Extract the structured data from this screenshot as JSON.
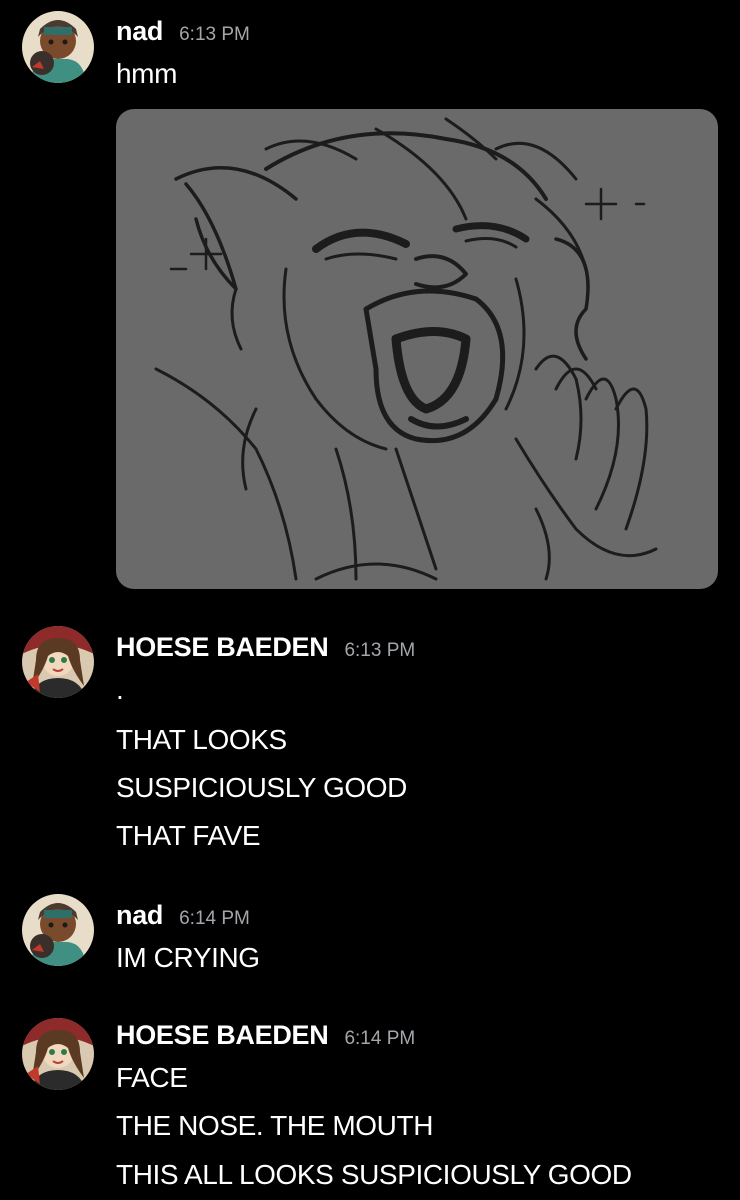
{
  "messages": [
    {
      "author": "nad",
      "time": "6:13 PM",
      "lines": [
        "hmm"
      ],
      "attachment": "sketch-image"
    },
    {
      "author": "HOESE BAEDEN",
      "time": "6:13 PM",
      "lines": [
        ".",
        "THAT LOOKS",
        "SUSPICIOUSLY GOOD",
        "THAT FAVE"
      ]
    },
    {
      "author": "nad",
      "time": "6:14 PM",
      "lines": [
        "IM CRYING"
      ]
    },
    {
      "author": "HOESE BAEDEN",
      "time": "6:14 PM",
      "lines": [
        "FACE",
        "THE NOSE. THE MOUTH",
        "THIS ALL LOOKS SUSPICIOUSLY GOOD"
      ]
    }
  ],
  "theme": {
    "background": "#000000",
    "username_color": "#ffffff",
    "timestamp_color": "#a3a6aa",
    "attachment_bg": "#6a6a6a"
  }
}
